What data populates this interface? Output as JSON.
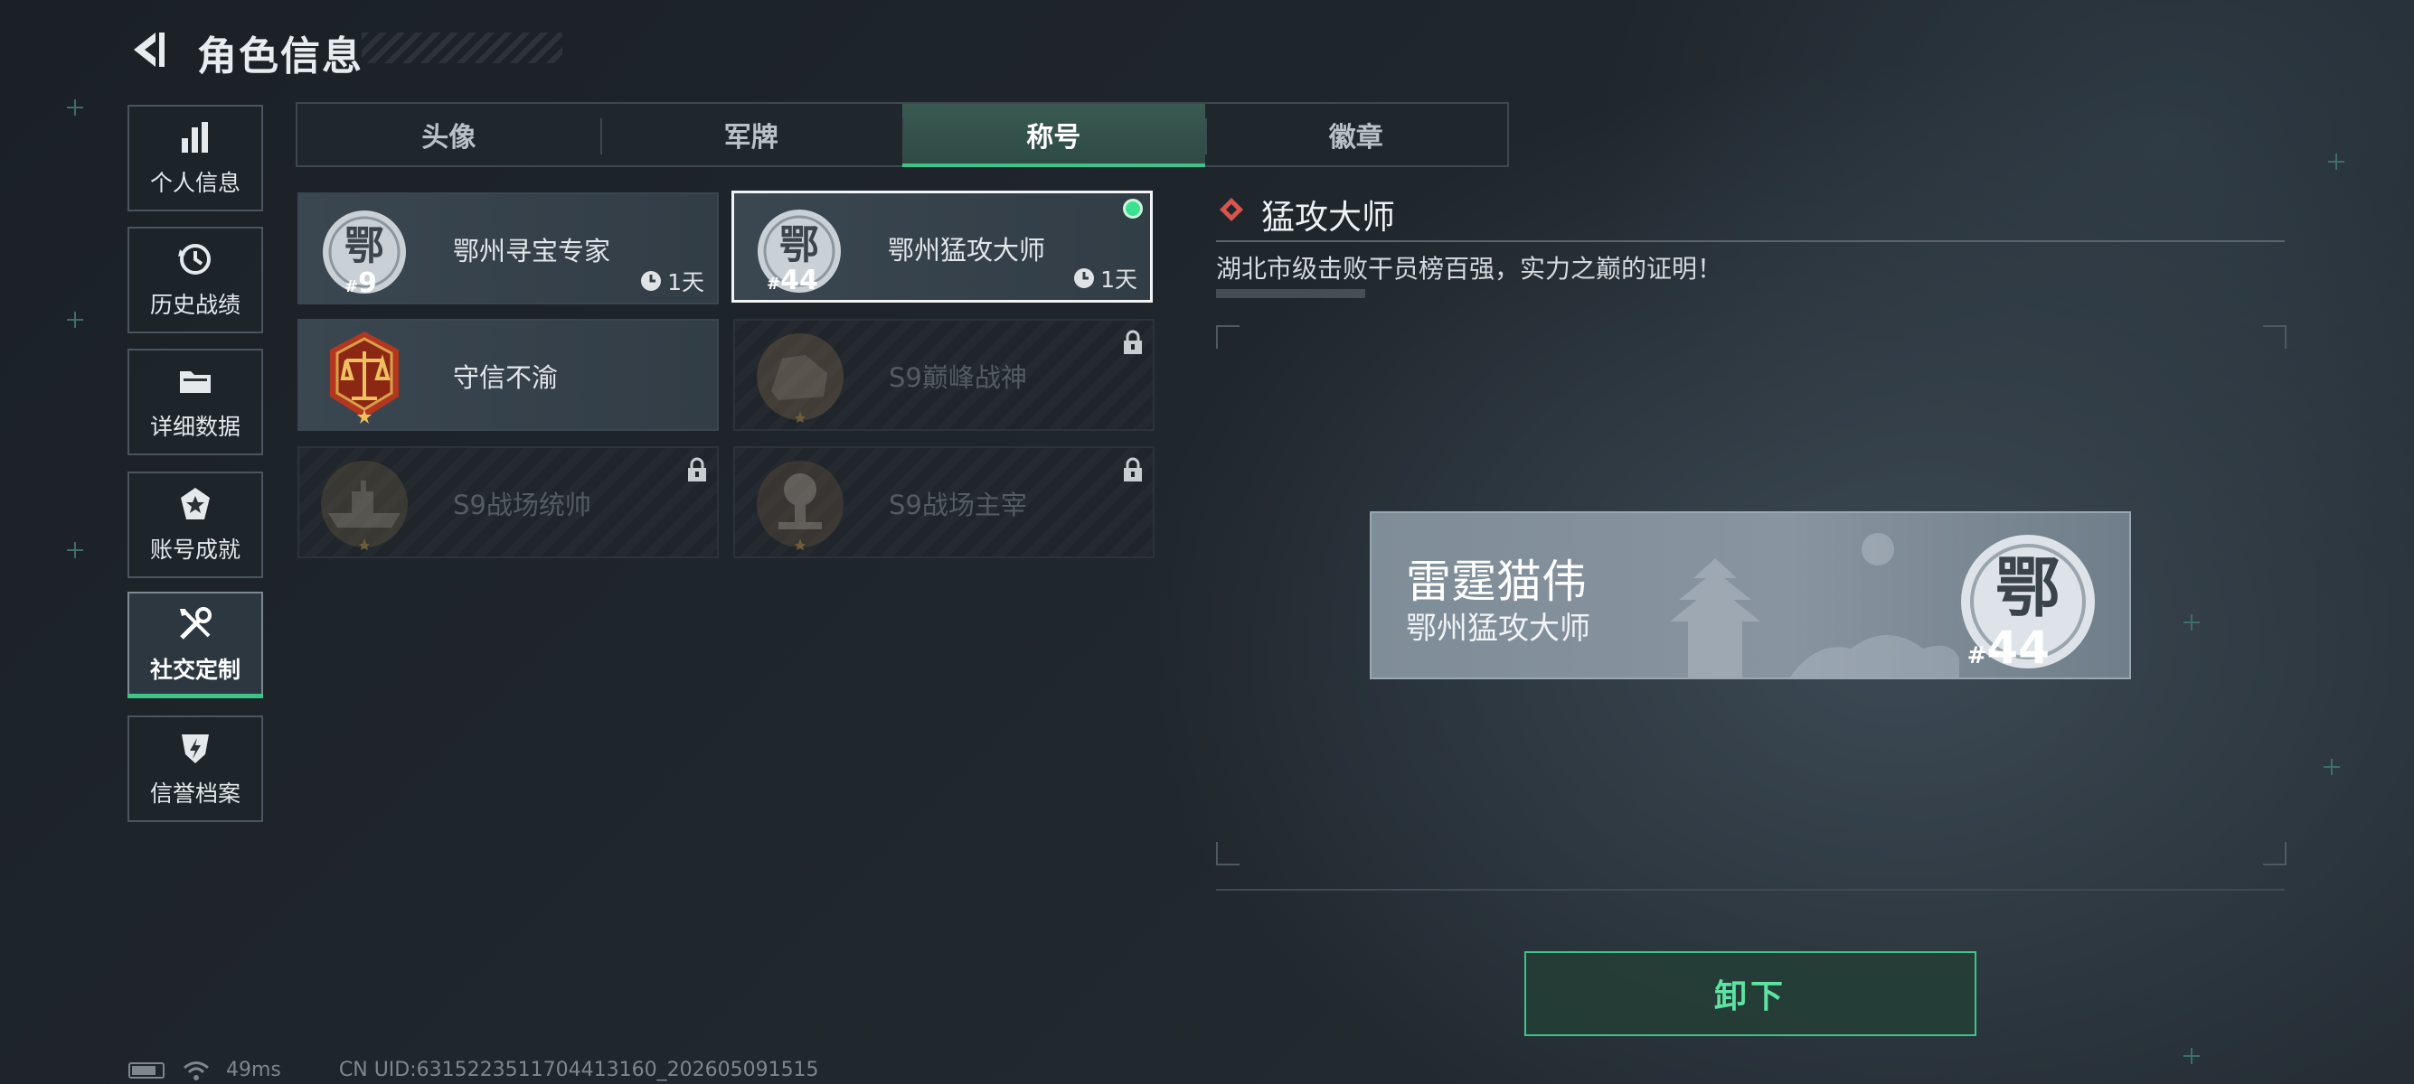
{
  "header": {
    "title": "角色信息"
  },
  "sidebar": {
    "items": [
      {
        "label": "个人信息",
        "icon": "bar-chart-icon"
      },
      {
        "label": "历史战绩",
        "icon": "history-icon"
      },
      {
        "label": "详细数据",
        "icon": "folder-icon"
      },
      {
        "label": "账号成就",
        "icon": "achievement-icon"
      },
      {
        "label": "社交定制",
        "icon": "tools-icon",
        "active": true
      },
      {
        "label": "信誉档案",
        "icon": "credit-shield-icon"
      }
    ]
  },
  "tabs": [
    {
      "label": "头像"
    },
    {
      "label": "军牌"
    },
    {
      "label": "称号",
      "active": true
    },
    {
      "label": "徽章"
    }
  ],
  "titles": [
    {
      "name": "鄂州寻宝专家",
      "rank": "9",
      "timer": "1天",
      "locked": false,
      "selected": false
    },
    {
      "name": "鄂州猛攻大师",
      "rank": "44",
      "timer": "1天",
      "locked": false,
      "selected": true,
      "equipped": true
    },
    {
      "name": "守信不渝",
      "locked": false,
      "selected": false
    },
    {
      "name": "S9巅峰战神",
      "locked": true
    },
    {
      "name": "S9战场统帅",
      "locked": true
    },
    {
      "name": "S9战场主宰",
      "locked": true
    }
  ],
  "detail": {
    "title": "猛攻大师",
    "description": "湖北市级击败干员榜百强，实力之巅的证明！"
  },
  "preview": {
    "player_name": "雷霆猫伟",
    "title": "鄂州猛攻大师",
    "rank": "44"
  },
  "action": {
    "label": "卸下"
  },
  "status": {
    "ping": "49ms",
    "uid": "CN UID:6315223511704413160_202605091515"
  },
  "colors": {
    "accent": "#3cc48a",
    "equipped": "#3de08e",
    "diamond": "#d9534f"
  }
}
